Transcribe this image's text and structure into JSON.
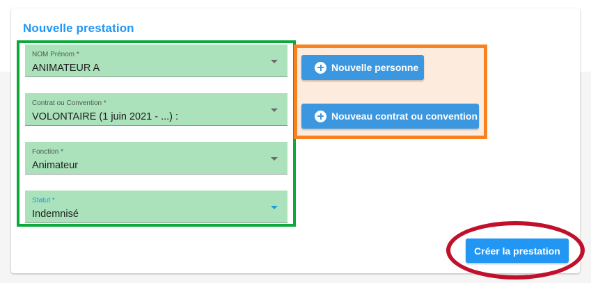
{
  "card": {
    "title": "Nouvelle prestation"
  },
  "form": {
    "fields": [
      {
        "label": "NOM Prénom *",
        "value": "ANIMATEUR A"
      },
      {
        "label": "Contrat ou Convention *",
        "value": "VOLONTAIRE (1 juin 2021 - ...) :"
      },
      {
        "label": "Fonction *",
        "value": "Animateur"
      },
      {
        "label": "Statut *",
        "value": "Indemnisé"
      }
    ]
  },
  "actions": {
    "new_person_label": "Nouvelle personne",
    "new_contract_label": "Nouveau contrat ou convention",
    "create_label": "Créer la prestation"
  },
  "icons": {
    "add": "plus-circle-icon",
    "dropdown": "chevron-down-icon"
  },
  "colors": {
    "accent": "#2196f3",
    "annotation_green": "#0ca83a",
    "annotation_orange": "#f7821f",
    "annotation_red": "#c0102c"
  }
}
